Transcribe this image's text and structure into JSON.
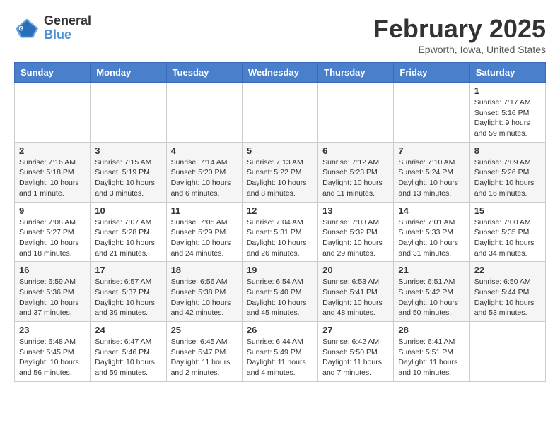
{
  "header": {
    "logo_general": "General",
    "logo_blue": "Blue",
    "month_year": "February 2025",
    "location": "Epworth, Iowa, United States"
  },
  "weekdays": [
    "Sunday",
    "Monday",
    "Tuesday",
    "Wednesday",
    "Thursday",
    "Friday",
    "Saturday"
  ],
  "weeks": [
    [
      {
        "day": "",
        "info": ""
      },
      {
        "day": "",
        "info": ""
      },
      {
        "day": "",
        "info": ""
      },
      {
        "day": "",
        "info": ""
      },
      {
        "day": "",
        "info": ""
      },
      {
        "day": "",
        "info": ""
      },
      {
        "day": "1",
        "info": "Sunrise: 7:17 AM\nSunset: 5:16 PM\nDaylight: 9 hours and 59 minutes."
      }
    ],
    [
      {
        "day": "2",
        "info": "Sunrise: 7:16 AM\nSunset: 5:18 PM\nDaylight: 10 hours and 1 minute."
      },
      {
        "day": "3",
        "info": "Sunrise: 7:15 AM\nSunset: 5:19 PM\nDaylight: 10 hours and 3 minutes."
      },
      {
        "day": "4",
        "info": "Sunrise: 7:14 AM\nSunset: 5:20 PM\nDaylight: 10 hours and 6 minutes."
      },
      {
        "day": "5",
        "info": "Sunrise: 7:13 AM\nSunset: 5:22 PM\nDaylight: 10 hours and 8 minutes."
      },
      {
        "day": "6",
        "info": "Sunrise: 7:12 AM\nSunset: 5:23 PM\nDaylight: 10 hours and 11 minutes."
      },
      {
        "day": "7",
        "info": "Sunrise: 7:10 AM\nSunset: 5:24 PM\nDaylight: 10 hours and 13 minutes."
      },
      {
        "day": "8",
        "info": "Sunrise: 7:09 AM\nSunset: 5:26 PM\nDaylight: 10 hours and 16 minutes."
      }
    ],
    [
      {
        "day": "9",
        "info": "Sunrise: 7:08 AM\nSunset: 5:27 PM\nDaylight: 10 hours and 18 minutes."
      },
      {
        "day": "10",
        "info": "Sunrise: 7:07 AM\nSunset: 5:28 PM\nDaylight: 10 hours and 21 minutes."
      },
      {
        "day": "11",
        "info": "Sunrise: 7:05 AM\nSunset: 5:29 PM\nDaylight: 10 hours and 24 minutes."
      },
      {
        "day": "12",
        "info": "Sunrise: 7:04 AM\nSunset: 5:31 PM\nDaylight: 10 hours and 26 minutes."
      },
      {
        "day": "13",
        "info": "Sunrise: 7:03 AM\nSunset: 5:32 PM\nDaylight: 10 hours and 29 minutes."
      },
      {
        "day": "14",
        "info": "Sunrise: 7:01 AM\nSunset: 5:33 PM\nDaylight: 10 hours and 31 minutes."
      },
      {
        "day": "15",
        "info": "Sunrise: 7:00 AM\nSunset: 5:35 PM\nDaylight: 10 hours and 34 minutes."
      }
    ],
    [
      {
        "day": "16",
        "info": "Sunrise: 6:59 AM\nSunset: 5:36 PM\nDaylight: 10 hours and 37 minutes."
      },
      {
        "day": "17",
        "info": "Sunrise: 6:57 AM\nSunset: 5:37 PM\nDaylight: 10 hours and 39 minutes."
      },
      {
        "day": "18",
        "info": "Sunrise: 6:56 AM\nSunset: 5:38 PM\nDaylight: 10 hours and 42 minutes."
      },
      {
        "day": "19",
        "info": "Sunrise: 6:54 AM\nSunset: 5:40 PM\nDaylight: 10 hours and 45 minutes."
      },
      {
        "day": "20",
        "info": "Sunrise: 6:53 AM\nSunset: 5:41 PM\nDaylight: 10 hours and 48 minutes."
      },
      {
        "day": "21",
        "info": "Sunrise: 6:51 AM\nSunset: 5:42 PM\nDaylight: 10 hours and 50 minutes."
      },
      {
        "day": "22",
        "info": "Sunrise: 6:50 AM\nSunset: 5:44 PM\nDaylight: 10 hours and 53 minutes."
      }
    ],
    [
      {
        "day": "23",
        "info": "Sunrise: 6:48 AM\nSunset: 5:45 PM\nDaylight: 10 hours and 56 minutes."
      },
      {
        "day": "24",
        "info": "Sunrise: 6:47 AM\nSunset: 5:46 PM\nDaylight: 10 hours and 59 minutes."
      },
      {
        "day": "25",
        "info": "Sunrise: 6:45 AM\nSunset: 5:47 PM\nDaylight: 11 hours and 2 minutes."
      },
      {
        "day": "26",
        "info": "Sunrise: 6:44 AM\nSunset: 5:49 PM\nDaylight: 11 hours and 4 minutes."
      },
      {
        "day": "27",
        "info": "Sunrise: 6:42 AM\nSunset: 5:50 PM\nDaylight: 11 hours and 7 minutes."
      },
      {
        "day": "28",
        "info": "Sunrise: 6:41 AM\nSunset: 5:51 PM\nDaylight: 11 hours and 10 minutes."
      },
      {
        "day": "",
        "info": ""
      }
    ]
  ]
}
